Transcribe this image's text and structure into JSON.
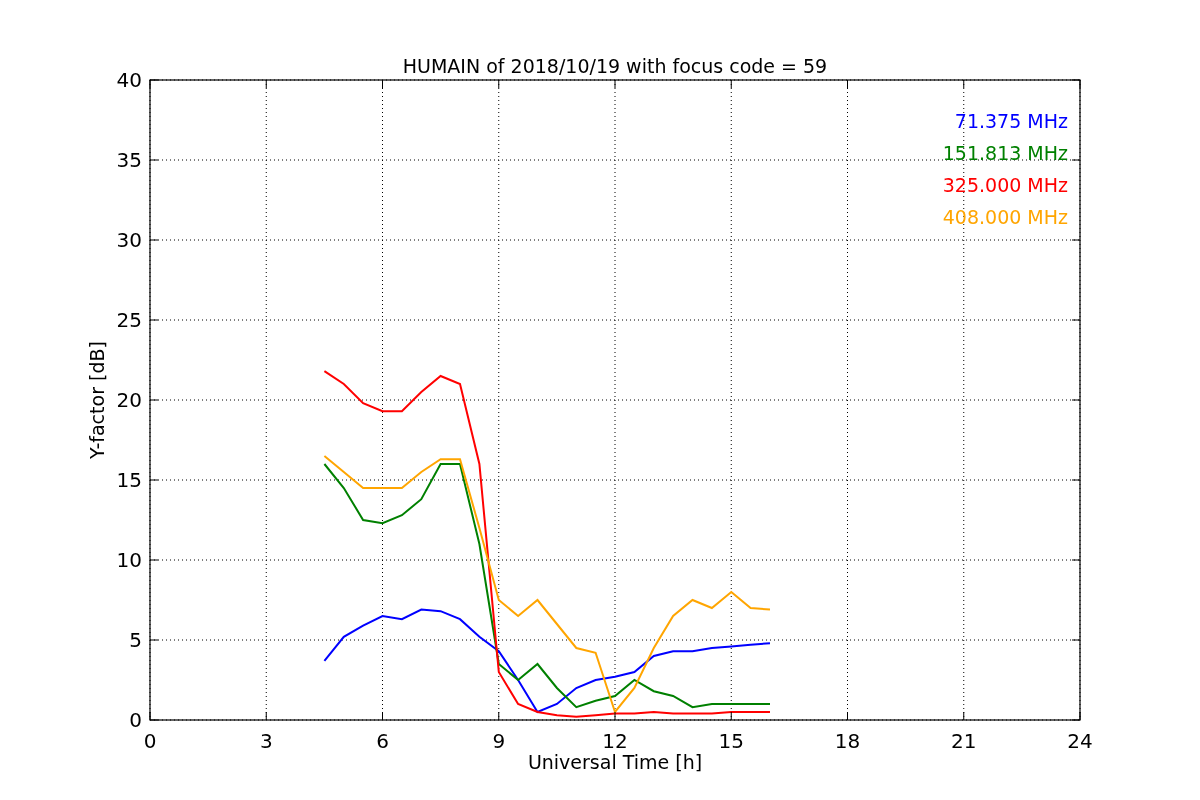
{
  "chart_data": {
    "type": "line",
    "title": "HUMAIN of 2018/10/19 with focus code = 59",
    "xlabel": "Universal Time [h]",
    "ylabel": "Y-factor [dB]",
    "x": [
      4.5,
      5,
      5.5,
      6,
      6.5,
      7,
      7.5,
      8,
      8.5,
      9,
      9.5,
      10,
      10.5,
      11,
      11.5,
      12,
      12.5,
      13,
      13.5,
      14,
      14.5,
      15,
      15.5,
      16
    ],
    "series": [
      {
        "name": "71.375 MHz",
        "color": "#0000ff",
        "values": [
          3.7,
          5.2,
          5.9,
          6.5,
          6.3,
          6.9,
          6.8,
          6.3,
          5.2,
          4.3,
          2.5,
          0.5,
          1.0,
          2.0,
          2.5,
          2.7,
          3.0,
          4.0,
          4.3,
          4.3,
          4.5,
          4.6,
          4.7,
          4.8
        ]
      },
      {
        "name": "151.813 MHz",
        "color": "#008000",
        "values": [
          16,
          14.5,
          12.5,
          12.3,
          12.8,
          13.8,
          16,
          16,
          11,
          3.5,
          2.5,
          3.5,
          2.0,
          0.8,
          1.2,
          1.5,
          2.5,
          1.8,
          1.5,
          0.8,
          1.0,
          1.0,
          1.0,
          1.0
        ]
      },
      {
        "name": "325.000 MHz",
        "color": "#ff0000",
        "values": [
          21.8,
          21,
          19.8,
          19.3,
          19.3,
          20.5,
          21.5,
          21,
          16,
          3,
          1.0,
          0.5,
          0.3,
          0.2,
          0.3,
          0.4,
          0.4,
          0.5,
          0.4,
          0.4,
          0.4,
          0.5,
          0.5,
          0.5
        ]
      },
      {
        "name": "408.000 MHz",
        "color": "#ffa500",
        "values": [
          16.5,
          15.5,
          14.5,
          14.5,
          14.5,
          15.5,
          16.3,
          16.3,
          12,
          7.5,
          6.5,
          7.5,
          6,
          4.5,
          4.2,
          0.5,
          2.0,
          4.5,
          6.5,
          7.5,
          7,
          8,
          7,
          6.9
        ]
      }
    ],
    "grid": true,
    "xlim": [
      0,
      24
    ],
    "ylim": [
      0,
      40
    ],
    "xticks": [
      0,
      3,
      6,
      9,
      12,
      15,
      18,
      21,
      24
    ],
    "yticks": [
      0,
      5,
      10,
      15,
      20,
      25,
      30,
      35,
      40
    ]
  }
}
